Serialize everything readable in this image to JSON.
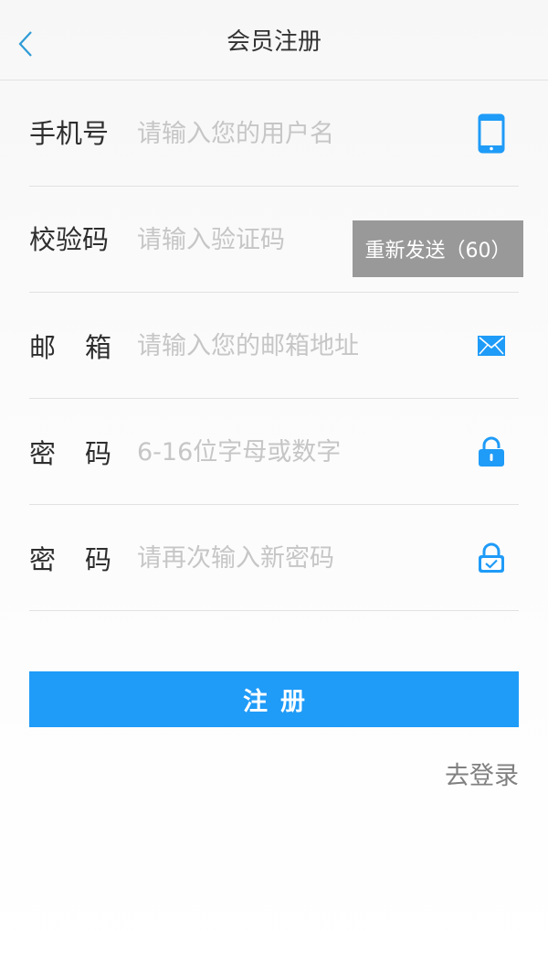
{
  "header": {
    "title": "会员注册"
  },
  "form": {
    "phone": {
      "label_chars": [
        "手机号"
      ],
      "placeholder": "请输入您的用户名",
      "icon": "phone-icon"
    },
    "code": {
      "label_chars": [
        "校验码"
      ],
      "placeholder": "请输入验证码",
      "resend_label": "重新发送（60）"
    },
    "email": {
      "label_chars": [
        "邮",
        "箱"
      ],
      "placeholder": "请输入您的邮箱地址",
      "icon": "envelope-icon"
    },
    "password": {
      "label_chars": [
        "密",
        "码"
      ],
      "placeholder": "6-16位字母或数字",
      "icon": "lock-icon"
    },
    "confirm_password": {
      "label_chars": [
        "密",
        "码"
      ],
      "placeholder": "请再次输入新密码",
      "icon": "lock-check-icon"
    }
  },
  "actions": {
    "submit_label": "注册",
    "login_link": "去登录"
  },
  "colors": {
    "accent": "#1f9bf8",
    "back_arrow": "#2e9bd6",
    "resend_bg": "#999999"
  }
}
